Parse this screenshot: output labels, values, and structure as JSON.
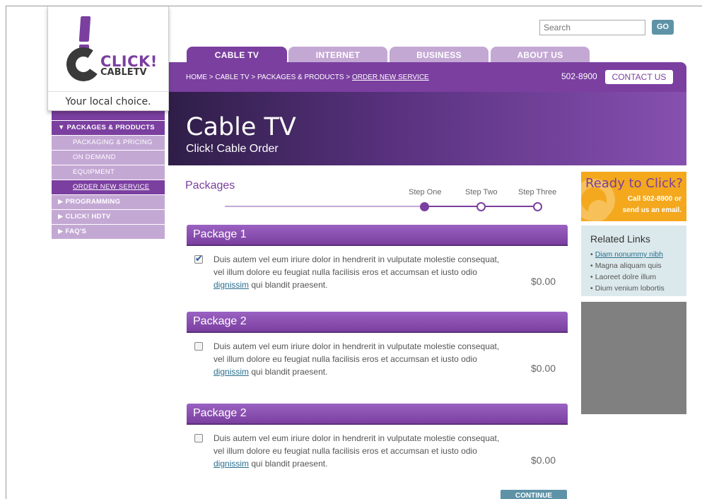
{
  "logo": {
    "brand_top": "CLICK!",
    "brand_bottom": "CABLETV",
    "tagline": "Your local choice."
  },
  "search": {
    "placeholder": "Search",
    "go_label": "GO"
  },
  "tabs": [
    {
      "label": "CABLE TV",
      "active": true
    },
    {
      "label": "INTERNET",
      "active": false
    },
    {
      "label": "BUSINESS",
      "active": false
    },
    {
      "label": "ABOUT US",
      "active": false
    }
  ],
  "breadcrumb": {
    "trail": "HOME > CABLE TV > PACKAGES & PRODUCTS > ",
    "current": "ORDER NEW SERVICE"
  },
  "header": {
    "phone": "502-8900",
    "contact_label": "CONTACT US"
  },
  "hero": {
    "title": "Cable TV",
    "subtitle": "Click! Cable Order"
  },
  "sidebar": {
    "items": [
      {
        "label": "▼  PACKAGES & PRODUCTS"
      },
      {
        "label": "PACKAGING & PRICING"
      },
      {
        "label": "ON DEMAND"
      },
      {
        "label": "EQUIPMENT"
      },
      {
        "label": "ORDER NEW SERVICE"
      },
      {
        "label": "▶  PROGRAMMING"
      },
      {
        "label": "▶  CLICK! HDTV"
      },
      {
        "label": "▶  FAQ'S"
      }
    ]
  },
  "main": {
    "heading": "Packages",
    "steps": [
      "Step One",
      "Step Two",
      "Step Three"
    ],
    "current_step": 1,
    "packages": [
      {
        "title": "Package 1",
        "checked": true,
        "text_before": "Duis autem vel eum iriure dolor in hendrerit in vulputate molestie consequat, vel illum dolore eu feugiat nulla facilisis eros et accumsan et iusto odio ",
        "link": "dignissim",
        "text_after": " qui blandit praesent.",
        "price": "$0.00"
      },
      {
        "title": "Package 2",
        "checked": false,
        "text_before": "Duis autem vel eum iriure dolor in hendrerit in vulputate molestie consequat, vel illum dolore eu feugiat nulla facilisis eros et accumsan et iusto odio ",
        "link": "dignissim",
        "text_after": " qui blandit praesent.",
        "price": "$0.00"
      },
      {
        "title": "Package 2",
        "checked": false,
        "text_before": "Duis autem vel eum iriure dolor in hendrerit in vulputate molestie consequat, vel illum dolore eu feugiat nulla facilisis eros et accumsan et iusto odio ",
        "link": "dignissim",
        "text_after": " qui blandit praesent.",
        "price": "$0.00"
      }
    ],
    "continue_label": "CONTINUE"
  },
  "promo": {
    "title": "Ready to Click?",
    "line1": "Call 502-8900 or",
    "line2": "send us an email."
  },
  "related": {
    "title": "Related Links",
    "links": [
      "Diam nonummy nibh",
      "Magna aliquam quis",
      "Laoreet dolre illum",
      "Dium venium lobortis"
    ]
  },
  "colors": {
    "brand_purple": "#7b3fa0",
    "light_purple": "#c4a8d4",
    "teal_button": "#5e93a7",
    "promo_orange": "#f4a81d",
    "related_bg": "#dce9ec",
    "placeholder_gray": "#808080"
  }
}
